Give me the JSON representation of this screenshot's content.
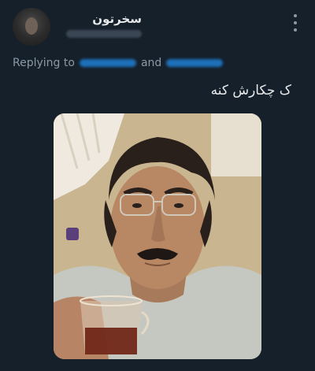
{
  "tweet": {
    "display_name": "سخرتون",
    "reply_prefix": "Replying to",
    "reply_conjunction": "and",
    "text": "ک چکارش کنه"
  },
  "icons": {
    "avatar": "user-avatar",
    "more": "more-vertical-icon",
    "photo": "tweet-photo"
  },
  "colors": {
    "background": "#15202b",
    "text_primary": "#e7e9ea",
    "text_secondary": "#8b98a5",
    "link": "#1d9bf0"
  }
}
